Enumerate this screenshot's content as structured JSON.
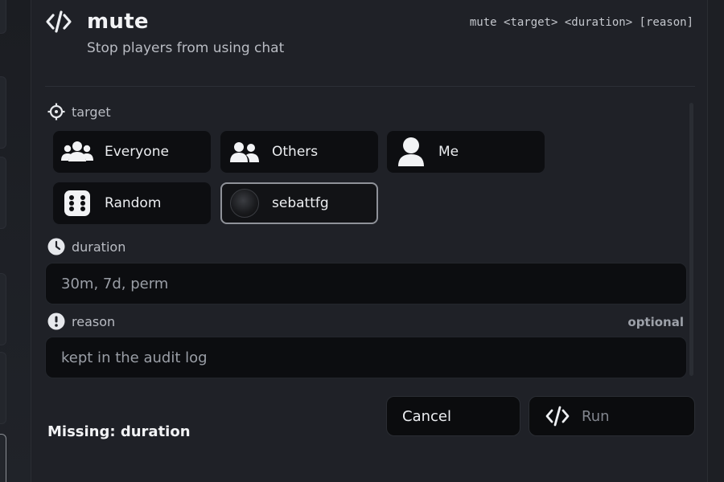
{
  "command": {
    "name": "mute",
    "description": "Stop players from using chat",
    "syntax": "mute <target> <duration> [reason]"
  },
  "target": {
    "label": "target",
    "options": [
      {
        "label": "Everyone",
        "icon": "users-icon",
        "selected": false
      },
      {
        "label": "Others",
        "icon": "users-icon",
        "selected": false
      },
      {
        "label": "Me",
        "icon": "user-icon",
        "selected": false
      },
      {
        "label": "Random",
        "icon": "dice-icon",
        "selected": false
      },
      {
        "label": "sebattfg",
        "icon": "avatar",
        "selected": true
      }
    ]
  },
  "duration": {
    "label": "duration",
    "placeholder": "30m, 7d, perm",
    "value": ""
  },
  "reason": {
    "label": "reason",
    "optional_label": "optional",
    "placeholder": "kept in the audit log",
    "value": ""
  },
  "footer": {
    "status": "Missing: duration",
    "cancel_label": "Cancel",
    "run_label": "Run"
  }
}
